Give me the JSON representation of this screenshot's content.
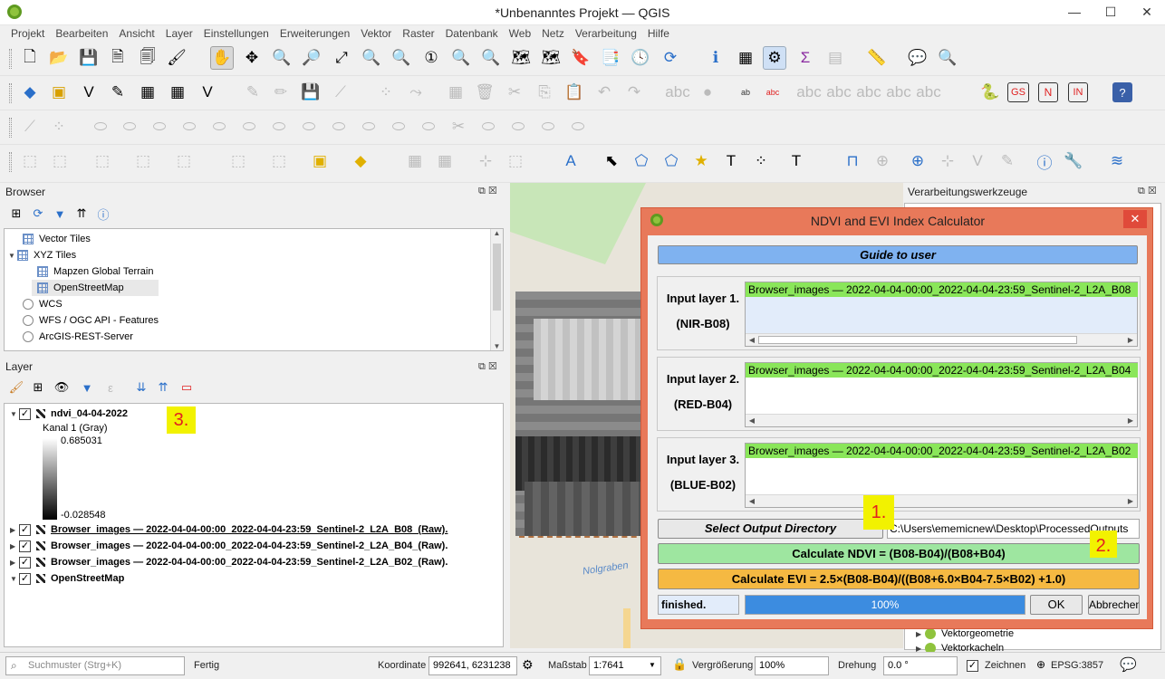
{
  "window": {
    "title": "*Unbenanntes Projekt — QGIS"
  },
  "menu": [
    "Projekt",
    "Bearbeiten",
    "Ansicht",
    "Layer",
    "Einstellungen",
    "Erweiterungen",
    "Vektor",
    "Raster",
    "Datenbank",
    "Web",
    "Netz",
    "Verarbeitung",
    "Hilfe"
  ],
  "browser": {
    "title": "Browser",
    "items": [
      {
        "label": "Vector Tiles"
      },
      {
        "label": "XYZ Tiles"
      },
      {
        "label": "Mapzen Global Terrain"
      },
      {
        "label": "OpenStreetMap"
      },
      {
        "label": "WCS"
      },
      {
        "label": "WFS / OGC API - Features"
      },
      {
        "label": "ArcGIS-REST-Server"
      }
    ]
  },
  "layers": {
    "title": "Layer",
    "ndvi": {
      "name": "ndvi_04-04-2022",
      "band": "Kanal 1 (Gray)",
      "max": "0.685031",
      "min": "-0.028548"
    },
    "items": [
      {
        "label": "Browser_images — 2022-04-04-00:00_2022-04-04-23:59_Sentinel-2_L2A_B08_(Raw)."
      },
      {
        "label": "Browser_images — 2022-04-04-00:00_2022-04-04-23:59_Sentinel-2_L2A_B04_(Raw)."
      },
      {
        "label": "Browser_images — 2022-04-04-00:00_2022-04-04-23:59_Sentinel-2_L2A_B02_(Raw)."
      },
      {
        "label": "OpenStreetMap"
      }
    ]
  },
  "tags": {
    "one": "1.",
    "two": "2.",
    "three": "3."
  },
  "processing": {
    "title": "Verarbeitungswerkzeuge",
    "items": [
      "Vektorgeometrie",
      "Vektorkacheln"
    ]
  },
  "map": {
    "label": "Nolgraben"
  },
  "dialog": {
    "title": "NDVI and EVI Index Calculator",
    "close": "✕",
    "guide": "Guide to user",
    "inputs": [
      {
        "label1": "Input layer 1.",
        "label2": "(NIR-B08)",
        "item": "Browser_images — 2022-04-04-00:00_2022-04-04-23:59_Sentinel-2_L2A_B08"
      },
      {
        "label1": "Input layer 2.",
        "label2": "(RED-B04)",
        "item": "Browser_images — 2022-04-04-00:00_2022-04-04-23:59_Sentinel-2_L2A_B04"
      },
      {
        "label1": "Input layer 3.",
        "label2": "(BLUE-B02)",
        "item": "Browser_images — 2022-04-04-00:00_2022-04-04-23:59_Sentinel-2_L2A_B02"
      }
    ],
    "output_button": "Select Output Directory",
    "output_path": "C:\\Users\\ememicnew\\Desktop\\ProcessedOutputs",
    "ndvi_button": "Calculate NDVI = (B08-B04)/(B08+B04)",
    "evi_button": "Calculate EVI = 2.5×(B08-B04)/((B08+6.0×B04-7.5×B02) +1.0)",
    "status": "finished.",
    "progress_text": "100%",
    "progress": 1.0,
    "ok": "OK",
    "cancel": "Abbrechen"
  },
  "statusbar": {
    "search_placeholder": "Suchmuster (Strg+K)",
    "ready": "Fertig",
    "coord_label": "Koordinate",
    "coord": "992641, 6231238",
    "scale_label": "Maßstab",
    "scale": "1:7641",
    "magnifier_label": "Vergrößerung",
    "magnifier": "100%",
    "rotation_label": "Drehung",
    "rotation": "0.0 °",
    "render_label": "Zeichnen",
    "crs": "EPSG:3857"
  },
  "colors": {
    "dialog_frame": "#e8795a",
    "guide_btn": "#7fb2f0",
    "ndvi_btn": "#9ee6a0",
    "evi_btn": "#f5b942",
    "list_item": "#8ae65a",
    "tag": "#f2f200"
  }
}
